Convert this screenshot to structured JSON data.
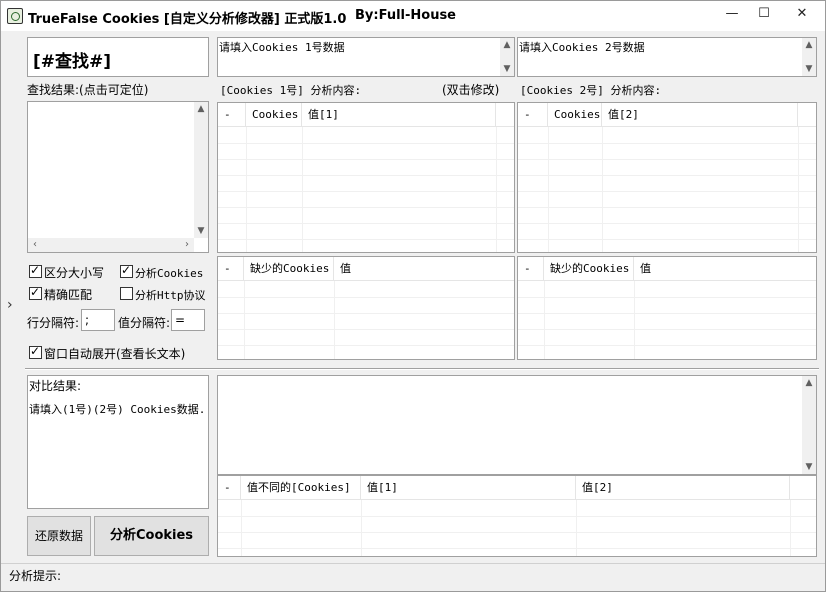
{
  "window": {
    "title": "TrueFalse Cookies [自定义分析修改器] 正式版1.0",
    "author": "By:Full-House",
    "controls": {
      "minimize": "—",
      "maximize": "☐",
      "close": "✕"
    }
  },
  "search": {
    "box_text": "[#查找#]",
    "results_label": "查找结果:(点击可定位)"
  },
  "input1": {
    "placeholder": "请填入Cookies 1号数据",
    "analysis_label": "[Cookies 1号] 分析内容:",
    "edit_hint": "(双击修改)"
  },
  "input2": {
    "placeholder": "请填入Cookies 2号数据",
    "analysis_label": "[Cookies 2号] 分析内容:"
  },
  "grid1": {
    "columns": [
      "-",
      "Cookies",
      "值[1]"
    ]
  },
  "grid2": {
    "columns": [
      "-",
      "Cookies",
      "值[2]"
    ]
  },
  "missing1": {
    "columns": [
      "-",
      "缺少的Cookies",
      "值"
    ]
  },
  "missing2": {
    "columns": [
      "-",
      "缺少的Cookies",
      "值"
    ]
  },
  "options": {
    "case_sensitive": {
      "label": "区分大小写",
      "checked": true
    },
    "analyze_cookies": {
      "label": "分析Cookies",
      "checked": true
    },
    "exact_match": {
      "label": "精确匹配",
      "checked": true
    },
    "analyze_http": {
      "label": "分析Http协议",
      "checked": false
    },
    "row_sep_label": "行分隔符:",
    "row_sep_value": ";",
    "val_sep_label": "值分隔符:",
    "val_sep_value": "=",
    "auto_expand": {
      "label": "窗口自动展开(查看长文本)",
      "checked": true
    }
  },
  "compare": {
    "label": "对比结果:",
    "text": "请填入(1号)(2号) Cookies数据."
  },
  "diff_grid": {
    "columns": [
      "-",
      "值不同的[Cookies]",
      "值[1]",
      "值[2]"
    ]
  },
  "buttons": {
    "restore": "还原数据",
    "analyze": "分析Cookies"
  },
  "status": {
    "label": "分析提示:"
  },
  "side_toggle": "›"
}
